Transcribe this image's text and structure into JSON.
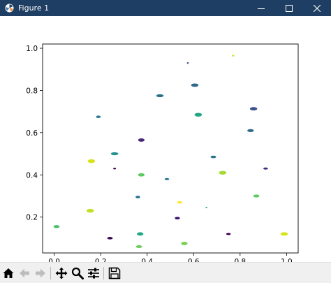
{
  "window": {
    "title": "Figure 1",
    "controls": [
      "minimize",
      "maximize",
      "close"
    ]
  },
  "toolbar": {
    "buttons": [
      {
        "name": "home",
        "icon": "home-icon"
      },
      {
        "name": "back",
        "icon": "arrow-left-icon"
      },
      {
        "name": "forward",
        "icon": "arrow-right-icon"
      },
      {
        "name": "pan",
        "icon": "move-icon"
      },
      {
        "name": "zoom",
        "icon": "magnifier-icon"
      },
      {
        "name": "configure-subplots",
        "icon": "sliders-icon"
      },
      {
        "name": "save",
        "icon": "floppy-icon"
      }
    ]
  },
  "chart_data": {
    "type": "scatter",
    "marker": "ellipse",
    "colormap": "viridis",
    "xlim": [
      -0.05,
      1.05
    ],
    "ylim": [
      0.03,
      1.02
    ],
    "xticks": [
      "0.0",
      "0.2",
      "0.4",
      "0.6",
      "0.8",
      "1.0"
    ],
    "yticks": [
      "0.2",
      "0.4",
      "0.6",
      "0.8",
      "1.0"
    ],
    "grid": false,
    "points": [
      {
        "x": 0.77,
        "y": 0.965,
        "rw": 0.005,
        "rh": 0.004,
        "color": "#d2e21b"
      },
      {
        "x": 0.575,
        "y": 0.93,
        "rw": 0.004,
        "rh": 0.004,
        "color": "#3b528b"
      },
      {
        "x": 0.605,
        "y": 0.825,
        "rw": 0.016,
        "rh": 0.008,
        "color": "#31688e"
      },
      {
        "x": 0.455,
        "y": 0.775,
        "rw": 0.016,
        "rh": 0.007,
        "color": "#2d708e"
      },
      {
        "x": 0.858,
        "y": 0.713,
        "rw": 0.016,
        "rh": 0.008,
        "color": "#3b528b"
      },
      {
        "x": 0.62,
        "y": 0.685,
        "rw": 0.016,
        "rh": 0.009,
        "color": "#21a685"
      },
      {
        "x": 0.19,
        "y": 0.675,
        "rw": 0.01,
        "rh": 0.006,
        "color": "#287d8e"
      },
      {
        "x": 0.845,
        "y": 0.61,
        "rw": 0.014,
        "rh": 0.007,
        "color": "#31688e"
      },
      {
        "x": 0.375,
        "y": 0.565,
        "rw": 0.014,
        "rh": 0.008,
        "color": "#482878"
      },
      {
        "x": 0.26,
        "y": 0.5,
        "rw": 0.016,
        "rh": 0.007,
        "color": "#21918c"
      },
      {
        "x": 0.685,
        "y": 0.485,
        "rw": 0.012,
        "rh": 0.006,
        "color": "#2c728e"
      },
      {
        "x": 0.16,
        "y": 0.465,
        "rw": 0.016,
        "rh": 0.009,
        "color": "#d8e219"
      },
      {
        "x": 0.26,
        "y": 0.43,
        "rw": 0.006,
        "rh": 0.004,
        "color": "#440154"
      },
      {
        "x": 0.91,
        "y": 0.43,
        "rw": 0.01,
        "rh": 0.005,
        "color": "#472d7b"
      },
      {
        "x": 0.725,
        "y": 0.41,
        "rw": 0.016,
        "rh": 0.009,
        "color": "#a5db36"
      },
      {
        "x": 0.375,
        "y": 0.4,
        "rw": 0.014,
        "rh": 0.008,
        "color": "#5ec962"
      },
      {
        "x": 0.485,
        "y": 0.38,
        "rw": 0.01,
        "rh": 0.005,
        "color": "#2a788e"
      },
      {
        "x": 0.36,
        "y": 0.295,
        "rw": 0.01,
        "rh": 0.006,
        "color": "#2c728e"
      },
      {
        "x": 0.87,
        "y": 0.3,
        "rw": 0.013,
        "rh": 0.007,
        "color": "#5ec962"
      },
      {
        "x": 0.54,
        "y": 0.27,
        "rw": 0.011,
        "rh": 0.006,
        "color": "#fde725"
      },
      {
        "x": 0.655,
        "y": 0.245,
        "rw": 0.004,
        "rh": 0.003,
        "color": "#1fa188"
      },
      {
        "x": 0.155,
        "y": 0.23,
        "rw": 0.016,
        "rh": 0.009,
        "color": "#c2df23"
      },
      {
        "x": 0.53,
        "y": 0.195,
        "rw": 0.011,
        "rh": 0.006,
        "color": "#3b0f70"
      },
      {
        "x": 0.01,
        "y": 0.155,
        "rw": 0.013,
        "rh": 0.007,
        "color": "#4ac16d"
      },
      {
        "x": 0.37,
        "y": 0.12,
        "rw": 0.014,
        "rh": 0.008,
        "color": "#22a884"
      },
      {
        "x": 0.75,
        "y": 0.12,
        "rw": 0.01,
        "rh": 0.005,
        "color": "#440154"
      },
      {
        "x": 0.99,
        "y": 0.12,
        "rw": 0.016,
        "rh": 0.008,
        "color": "#d8e219"
      },
      {
        "x": 0.24,
        "y": 0.1,
        "rw": 0.012,
        "rh": 0.006,
        "color": "#3e0751"
      },
      {
        "x": 0.56,
        "y": 0.075,
        "rw": 0.014,
        "rh": 0.008,
        "color": "#7ad151"
      },
      {
        "x": 0.365,
        "y": 0.06,
        "rw": 0.013,
        "rh": 0.007,
        "color": "#6ccd5a"
      }
    ]
  }
}
